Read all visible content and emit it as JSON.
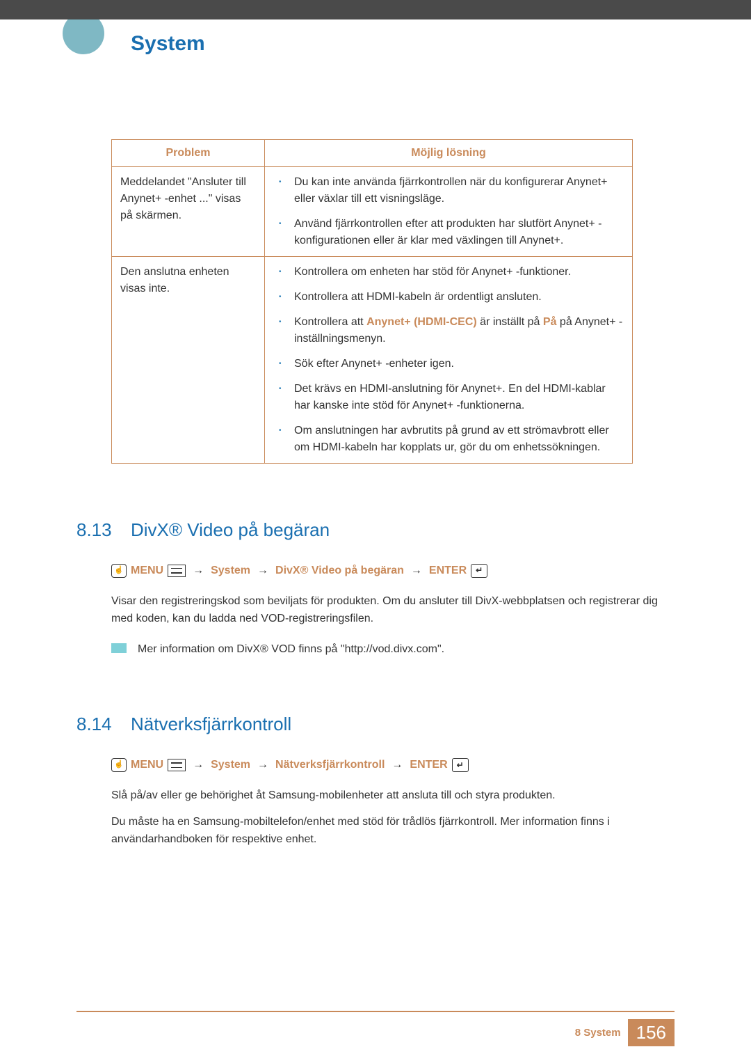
{
  "header": {
    "chapter_title": "System"
  },
  "table": {
    "headers": {
      "problem": "Problem",
      "solution": "Möjlig lösning"
    },
    "rows": [
      {
        "problem": "Meddelandet \"Ansluter till Anynet+ -enhet ...\" visas på skärmen.",
        "solutions": [
          {
            "plain": "Du kan inte använda fjärrkontrollen när du konfigurerar Anynet+ eller växlar till ett visningsläge."
          },
          {
            "plain": "Använd fjärrkontrollen efter att produkten har slutfört Anynet+ -konfigurationen eller är klar med växlingen till Anynet+."
          }
        ]
      },
      {
        "problem": "Den anslutna enheten visas inte.",
        "solutions": [
          {
            "plain": "Kontrollera om enheten har stöd för Anynet+ -funktioner."
          },
          {
            "plain": "Kontrollera att HDMI-kabeln är ordentligt ansluten."
          },
          {
            "prefix": "Kontrollera att ",
            "hl1": "Anynet+ (HDMI-CEC)",
            "mid": " är inställt på ",
            "hl2": "På",
            "suffix": " på Anynet+ -inställningsmenyn."
          },
          {
            "plain": "Sök efter Anynet+ -enheter igen."
          },
          {
            "plain": "Det krävs en HDMI-anslutning för Anynet+. En del HDMI-kablar har kanske inte stöd för Anynet+ -funktionerna."
          },
          {
            "plain": "Om anslutningen har avbrutits på grund av ett strömavbrott eller om HDMI-kabeln har kopplats ur, gör du om enhetssökningen."
          }
        ]
      }
    ]
  },
  "section1": {
    "num": "8.13",
    "title": "DivX® Video på begäran",
    "nav": {
      "menu": "MENU",
      "system": "System",
      "item": "DivX® Video på begäran",
      "enter": "ENTER"
    },
    "p1": "Visar den registreringskod som beviljats för produkten. Om du ansluter till DivX-webbplatsen och registrerar dig med koden, kan du ladda ned VOD-registreringsfilen.",
    "note": "Mer information om DivX® VOD finns på \"http://vod.divx.com\"."
  },
  "section2": {
    "num": "8.14",
    "title": "Nätverksfjärrkontroll",
    "nav": {
      "menu": "MENU",
      "system": "System",
      "item": "Nätverksfjärrkontroll",
      "enter": "ENTER"
    },
    "p1": "Slå på/av eller ge behörighet åt Samsung-mobilenheter att ansluta till och styra produkten.",
    "p2": "Du måste ha en Samsung-mobiltelefon/enhet med stöd för trådlös fjärrkontroll. Mer information finns i användarhandboken för respektive enhet."
  },
  "footer": {
    "chapter": "8 System",
    "page": "156"
  }
}
